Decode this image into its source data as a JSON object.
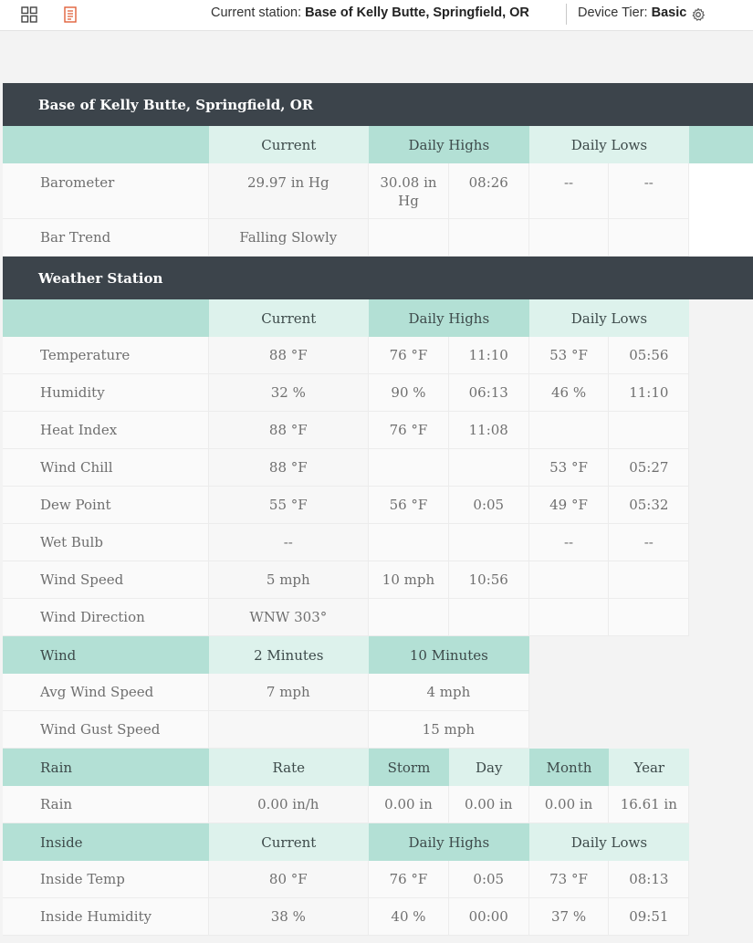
{
  "topbar": {
    "station_label": "Current station:",
    "station_name": "Base of Kelly Butte, Springfield, OR",
    "tier_label": "Device Tier:",
    "tier_value": "Basic",
    "icons": [
      "grid-icon",
      "document-icon",
      "gear-icon"
    ],
    "accent_color": "#e0603a"
  },
  "barometer_section": {
    "title": "Base of Kelly Butte, Springfield, OR",
    "headers": {
      "label": "",
      "current": "Current",
      "highs": "Daily Highs",
      "lows": "Daily Lows"
    },
    "rows": [
      {
        "label": "Barometer",
        "current": "29.97 in Hg",
        "high": "30.08 in Hg",
        "high_time": "08:26",
        "low": "--",
        "low_time": "--"
      },
      {
        "label": "Bar Trend",
        "current": "Falling Slowly",
        "high": "",
        "high_time": "",
        "low": "",
        "low_time": ""
      }
    ]
  },
  "station_section": {
    "title": "Weather Station",
    "headers": {
      "label": "",
      "current": "Current",
      "highs": "Daily Highs",
      "lows": "Daily Lows"
    },
    "rows": [
      {
        "label": "Temperature",
        "current": "88 °F",
        "high": "76 °F",
        "high_time": "11:10",
        "low": "53 °F",
        "low_time": "05:56"
      },
      {
        "label": "Humidity",
        "current": "32 %",
        "high": "90 %",
        "high_time": "06:13",
        "low": "46 %",
        "low_time": "11:10"
      },
      {
        "label": "Heat Index",
        "current": "88 °F",
        "high": "76 °F",
        "high_time": "11:08",
        "low": "",
        "low_time": ""
      },
      {
        "label": "Wind Chill",
        "current": "88 °F",
        "high": "",
        "high_time": "",
        "low": "53 °F",
        "low_time": "05:27"
      },
      {
        "label": "Dew Point",
        "current": "55 °F",
        "high": "56 °F",
        "high_time": "0:05",
        "low": "49 °F",
        "low_time": "05:32"
      },
      {
        "label": "Wet Bulb",
        "current": "--",
        "high": "",
        "high_time": "",
        "low": "--",
        "low_time": "--"
      },
      {
        "label": "Wind Speed",
        "current": "5 mph",
        "high": "10 mph",
        "high_time": "10:56",
        "low": "",
        "low_time": ""
      },
      {
        "label": "Wind Direction",
        "current": "WNW 303°",
        "high": "",
        "high_time": "",
        "low": "",
        "low_time": ""
      }
    ]
  },
  "wind_section": {
    "headers": {
      "label": "Wind",
      "two_min": "2 Minutes",
      "ten_min": "10 Minutes"
    },
    "rows": [
      {
        "label": "Avg Wind Speed",
        "two_min": "7 mph",
        "ten_min": "4 mph"
      },
      {
        "label": "Wind Gust Speed",
        "two_min": "",
        "ten_min": "15 mph"
      }
    ]
  },
  "rain_section": {
    "headers": {
      "label": "Rain",
      "rate": "Rate",
      "storm": "Storm",
      "day": "Day",
      "month": "Month",
      "year": "Year"
    },
    "row": {
      "label": "Rain",
      "rate": "0.00 in/h",
      "storm": "0.00 in",
      "day": "0.00 in",
      "month": "0.00 in",
      "year": "16.61 in"
    }
  },
  "inside_section": {
    "headers": {
      "label": "Inside",
      "current": "Current",
      "highs": "Daily Highs",
      "lows": "Daily Lows"
    },
    "rows": [
      {
        "label": "Inside Temp",
        "current": "80 °F",
        "high": "76 °F",
        "high_time": "0:05",
        "low": "73 °F",
        "low_time": "08:13"
      },
      {
        "label": "Inside Humidity",
        "current": "38 %",
        "high": "40 %",
        "high_time": "00:00",
        "low": "37 %",
        "low_time": "09:51"
      }
    ]
  }
}
